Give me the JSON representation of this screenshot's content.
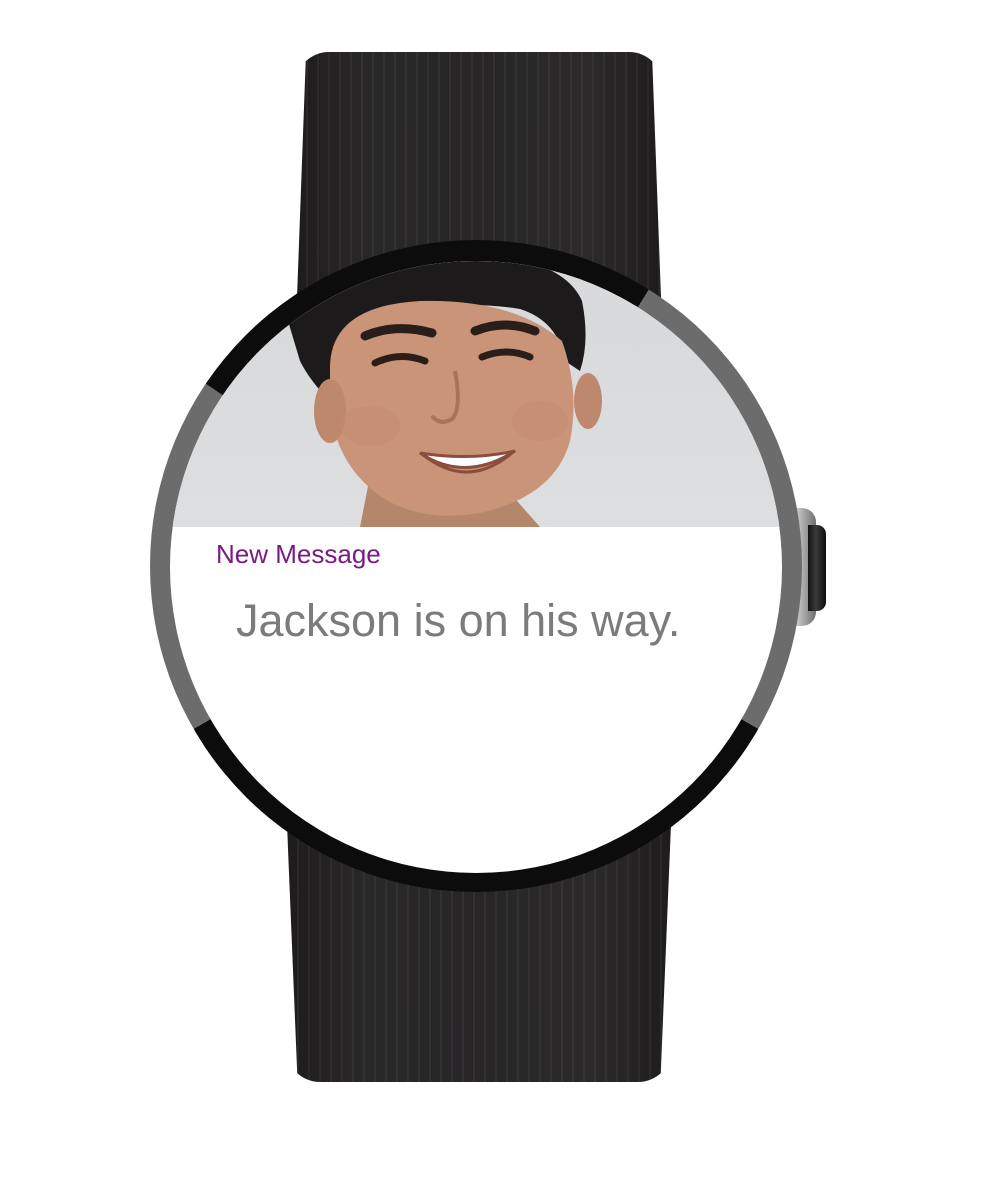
{
  "notification": {
    "title": "New Message",
    "message": "Jackson is on his way.",
    "title_color": "#7a1b85",
    "message_color": "#7b7b7b"
  },
  "sender_photo": {
    "icon": "avatar-photo"
  }
}
